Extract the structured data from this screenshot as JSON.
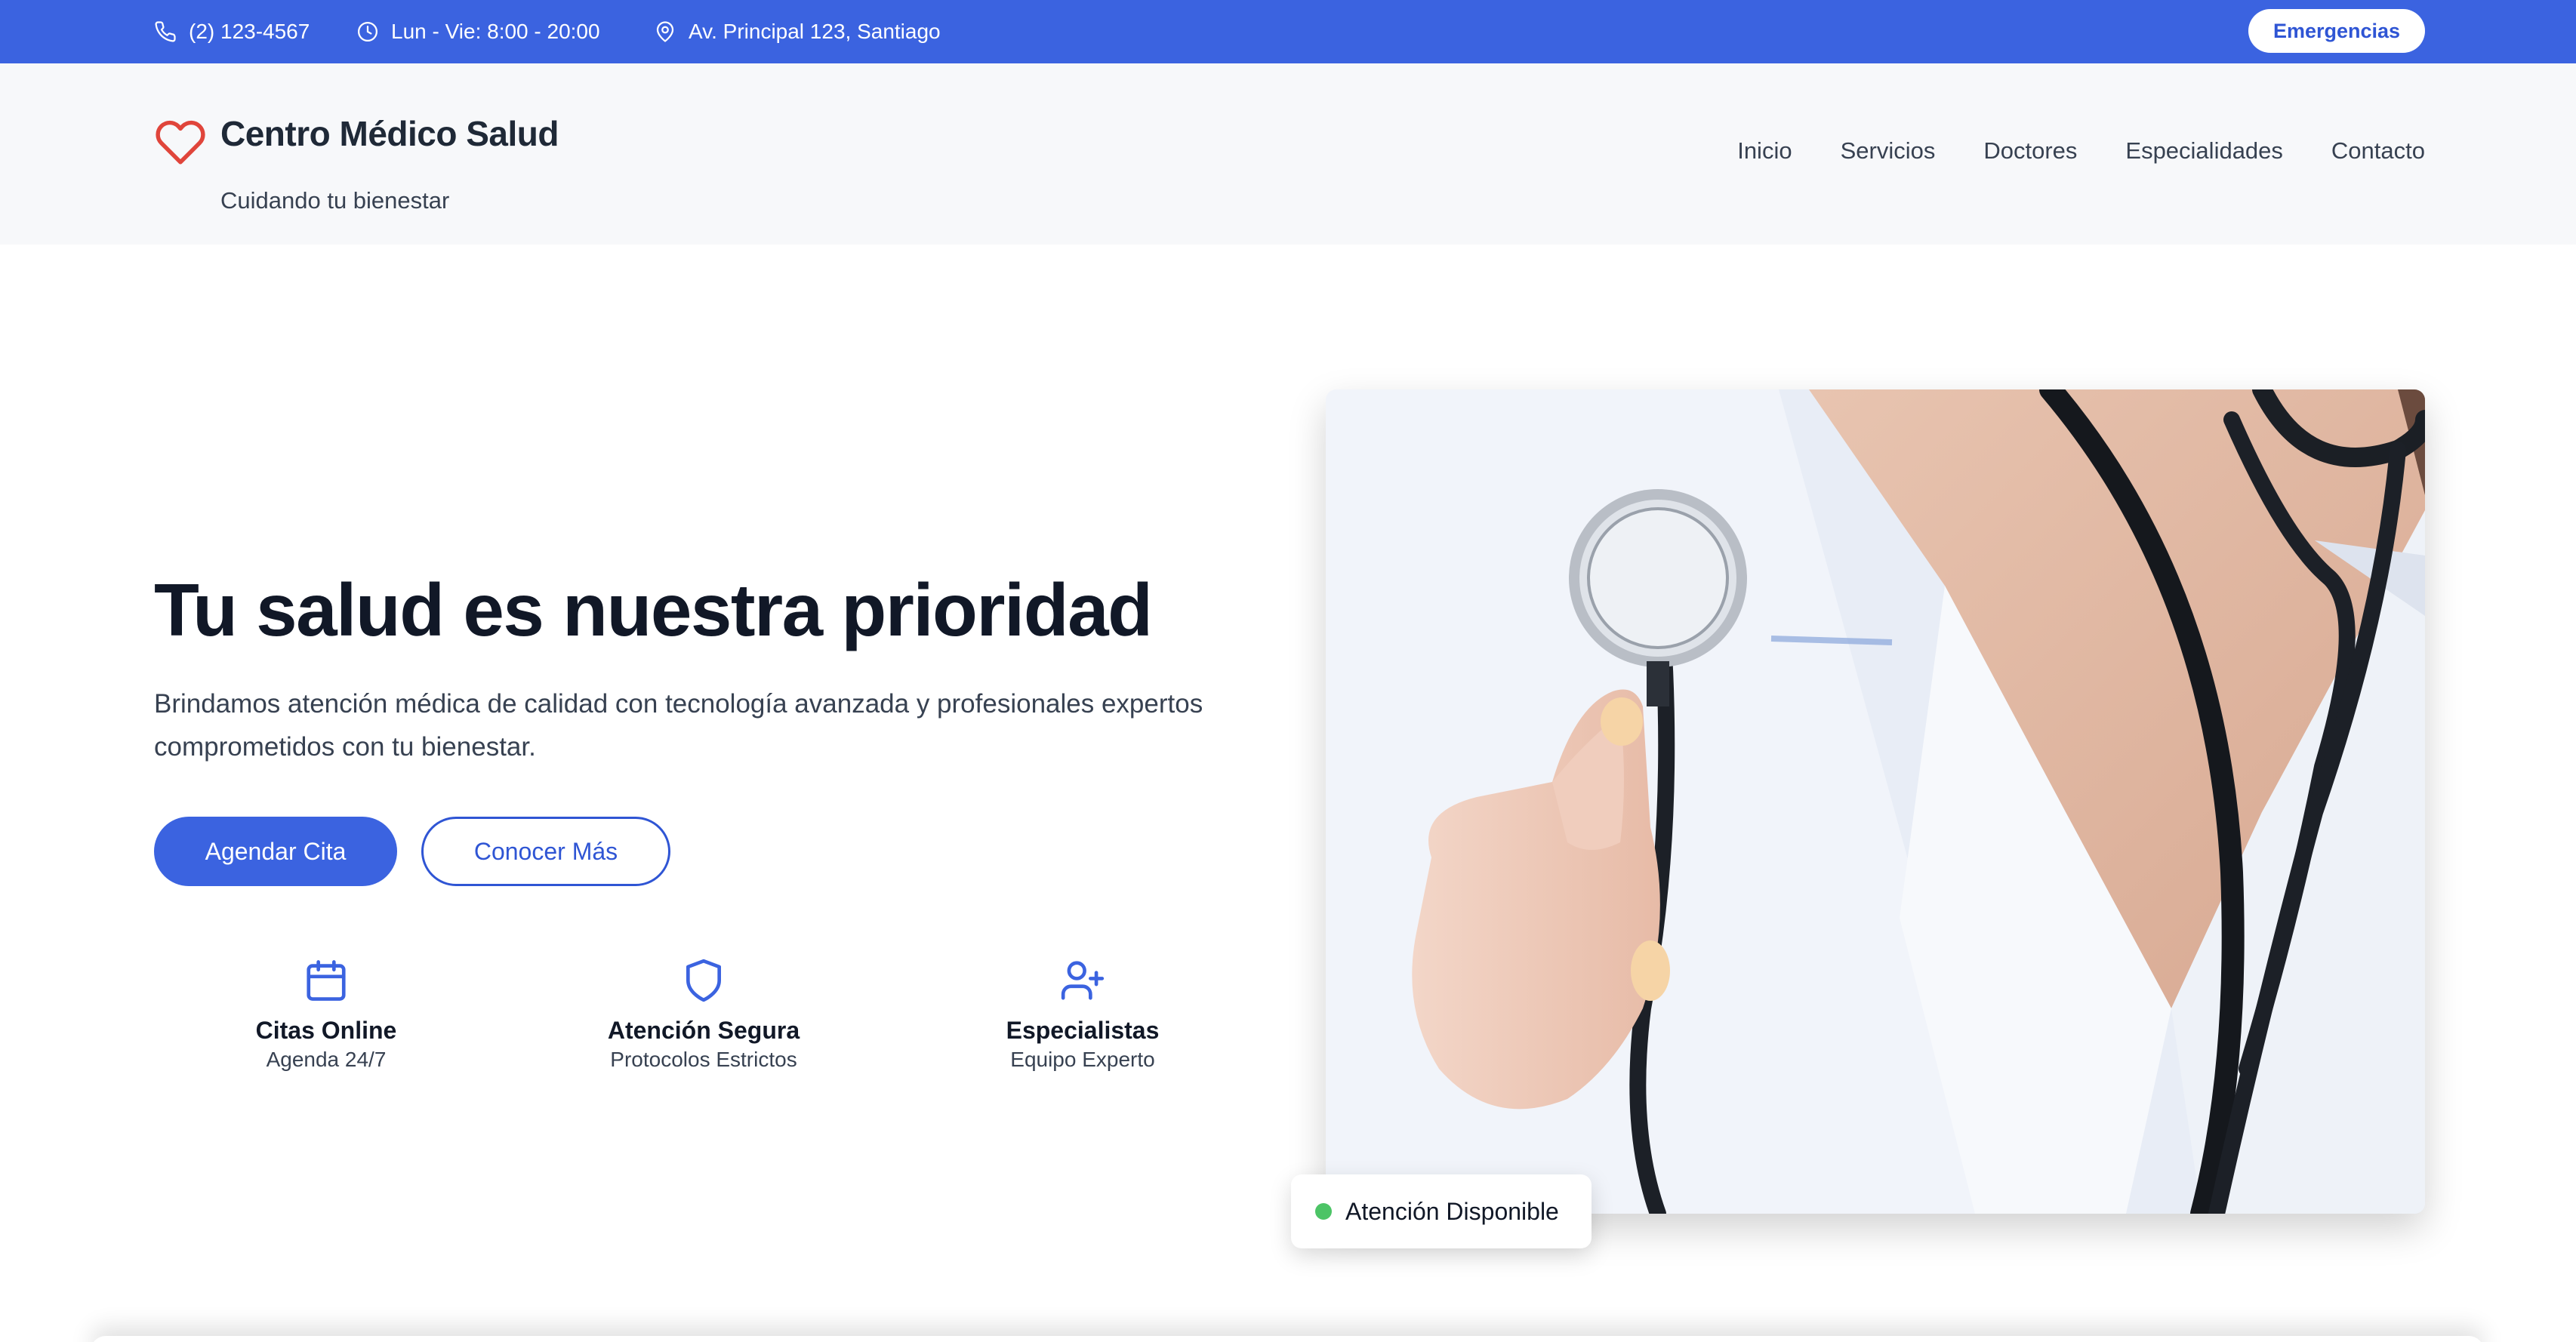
{
  "topbar": {
    "phone": "(2) 123-4567",
    "hours": "Lun - Vie: 8:00 - 20:00",
    "address": "Av. Principal 123, Santiago",
    "emergency_label": "Emergencias"
  },
  "header": {
    "brand": "Centro Médico Salud",
    "tagline": "Cuidando tu bienestar",
    "nav": [
      "Inicio",
      "Servicios",
      "Doctores",
      "Especialidades",
      "Contacto"
    ]
  },
  "hero": {
    "title": "Tu salud es nuestra prioridad",
    "description": "Brindamos atención médica de calidad con tecnología avanzada y profesionales expertos comprometidos con tu bienestar.",
    "primary_button": "Agendar Cita",
    "secondary_button": "Conocer Más",
    "features": [
      {
        "icon": "calendar-icon",
        "title": "Citas Online",
        "subtitle": "Agenda 24/7"
      },
      {
        "icon": "shield-icon",
        "title": "Atención Segura",
        "subtitle": "Protocolos Estrictos"
      },
      {
        "icon": "user-plus-icon",
        "title": "Especialistas",
        "subtitle": "Equipo Experto"
      }
    ],
    "badge": "Atención Disponible",
    "status_color": "#4cc466"
  },
  "colors": {
    "accent": "#3b63e0",
    "logo_heart": "#e0453b"
  }
}
